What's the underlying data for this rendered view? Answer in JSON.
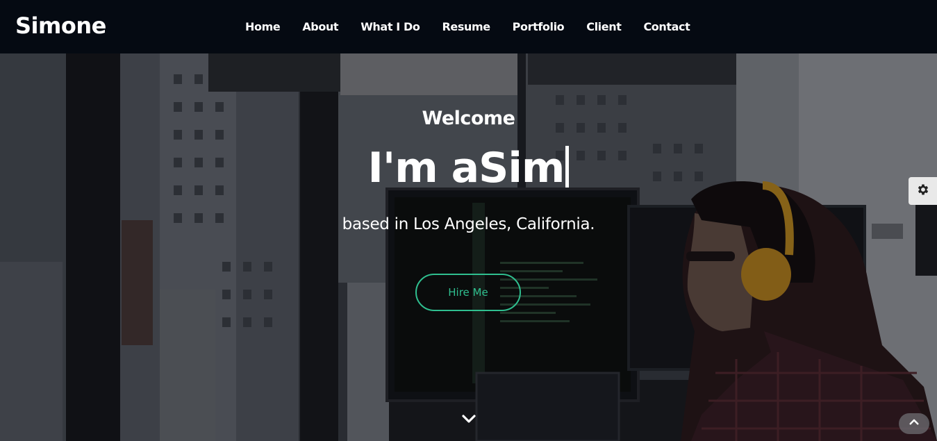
{
  "brand": {
    "name": "Simone"
  },
  "nav": {
    "items": [
      {
        "label": "Home"
      },
      {
        "label": "About"
      },
      {
        "label": "What I Do"
      },
      {
        "label": "Resume"
      },
      {
        "label": "Portfolio"
      },
      {
        "label": "Client"
      },
      {
        "label": "Contact"
      }
    ]
  },
  "hero": {
    "welcome": "Welcome",
    "headline": "I'm aSim",
    "tagline": "based in Los Angeles, California.",
    "cta_label": "Hire Me"
  },
  "icons": {
    "scroll_down": "chevron-down-icon",
    "settings": "gear-icon",
    "back_to_top": "chevron-up-icon"
  },
  "colors": {
    "navbar_bg": "#050a12",
    "accent": "#2fbf8f",
    "text": "#ffffff"
  }
}
